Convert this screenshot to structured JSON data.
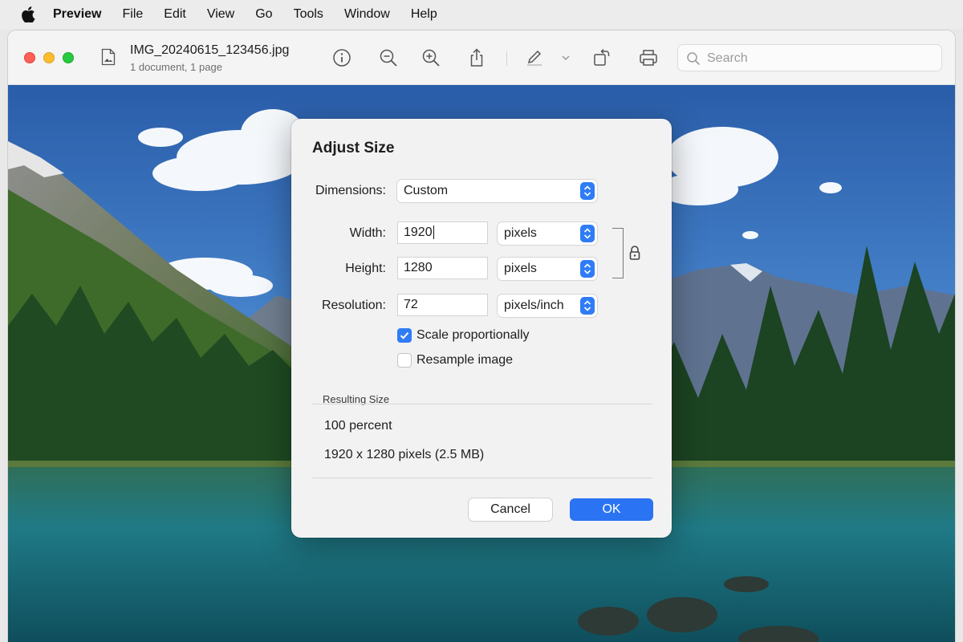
{
  "menubar": {
    "app_name": "Preview",
    "items": [
      "File",
      "Edit",
      "View",
      "Go",
      "Tools",
      "Window",
      "Help"
    ]
  },
  "window": {
    "title": "IMG_20240615_123456.jpg",
    "subtitle": "1 document, 1 page",
    "toolbar_icons": [
      "info-icon",
      "zoom-out-icon",
      "zoom-in-icon",
      "share-icon",
      "markup-icon",
      "chevron-down-icon",
      "rotate-icon",
      "print-icon"
    ],
    "search": {
      "placeholder": "Search",
      "value": ""
    }
  },
  "dialog": {
    "title": "Adjust Size",
    "dimensions_label": "Dimensions:",
    "dimensions_value": "Custom",
    "width_label": "Width:",
    "width_value": "1920",
    "width_unit": "pixels",
    "height_label": "Height:",
    "height_value": "1280",
    "height_unit": "pixels",
    "resolution_label": "Resolution:",
    "resolution_value": "72",
    "resolution_unit": "pixels/inch",
    "scale_label": "Scale proportionally",
    "scale_checked": true,
    "resample_label": "Resample image",
    "resample_checked": false,
    "resulting_size_label": "Resulting Size",
    "result_percent": "100 percent",
    "result_size": "1920 x 1280 pixels (2.5 MB)",
    "cancel_label": "Cancel",
    "ok_label": "OK"
  },
  "colors": {
    "accent": "#2f7cf6",
    "close": "#fe5f57",
    "minimize": "#febc2e",
    "maximize": "#28c840"
  }
}
